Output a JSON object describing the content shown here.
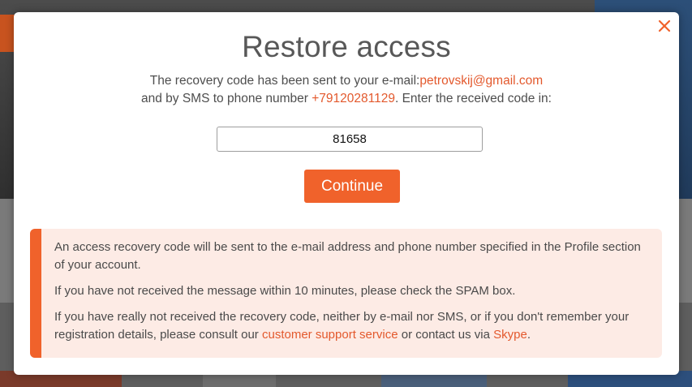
{
  "modal": {
    "title": "Restore access",
    "message": {
      "line1_text": "The recovery code has been sent to your e-mail:",
      "email": "petrovskij@gmail.com",
      "line2_prefix": "and by SMS to phone number ",
      "phone": "+79120281129",
      "line2_suffix": ". Enter the received code in:"
    },
    "code_input": {
      "value": "81658",
      "placeholder": ""
    },
    "continue_label": "Continue",
    "close_icon": "close-icon"
  },
  "info": {
    "paragraph1": "An access recovery code will be sent to the e-mail address and phone number specified in the Profile section of your account.",
    "paragraph2": "If you have not received the message within 10 minutes, please check the SPAM box.",
    "paragraph3_prefix": "If you have really not received the recovery code, neither by e-mail nor SMS, or if you don't remember your registration details, please consult our ",
    "support_link": "customer support service",
    "paragraph3_middle": " or contact us via ",
    "skype_link": "Skype",
    "paragraph3_suffix": "."
  },
  "colors": {
    "accent": "#f0622b",
    "link": "#e3592d",
    "info_background": "#fdebe5",
    "title": "#585858"
  }
}
